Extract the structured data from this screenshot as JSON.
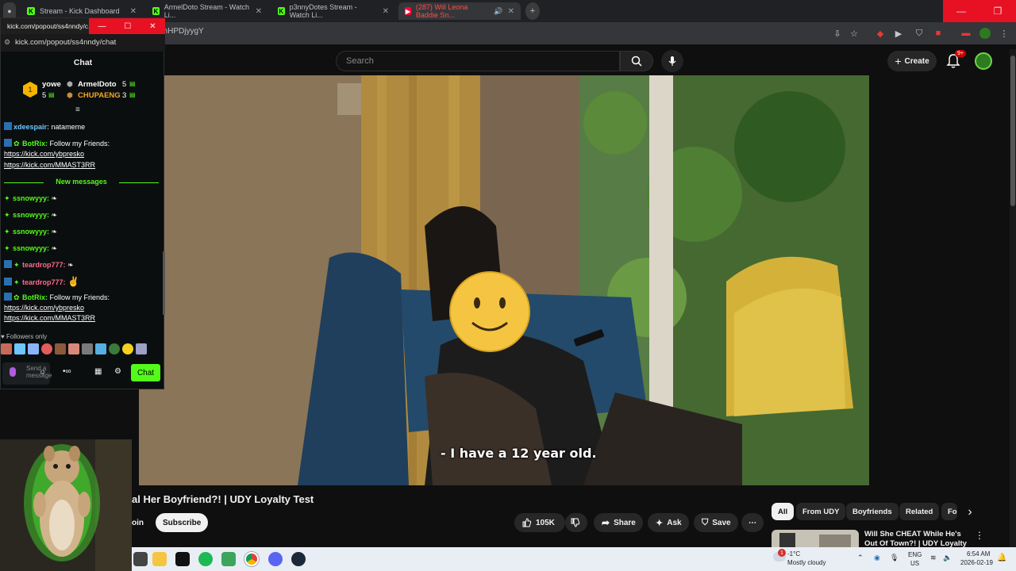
{
  "browser": {
    "tabs": [
      {
        "title": "Stream - Kick Dashboard"
      },
      {
        "title": "ArmelDoto Stream - Watch Li..."
      },
      {
        "title": "p3nnyDotes Stream - Watch Li..."
      },
      {
        "title": "(287) Will Leona Baddie Sn..."
      }
    ],
    "url_fragment": "enHPDjyygY"
  },
  "kick": {
    "window_title": "kick.com/popout/ss4nndy/c...",
    "url": "kick.com/popout/ss4nndy/chat",
    "header": "Chat",
    "leaderboard": [
      {
        "rank": "1",
        "name": "yowe",
        "count": "5"
      },
      {
        "name": "ArmelDoto",
        "count": "5"
      },
      {
        "name": "CHUPAENG",
        "count": "3"
      }
    ],
    "messages_top": [
      {
        "user": "xdeespair:",
        "text": "natameme"
      },
      {
        "user": "BotRix:",
        "text": "Follow my Friends:",
        "links": [
          "https://kick.com/ybpresko",
          "https://kick.com/MMAST3RR"
        ]
      }
    ],
    "new_messages_label": "New messages",
    "messages_new": [
      {
        "user": "ssnowyyy:"
      },
      {
        "user": "ssnowyyy:"
      },
      {
        "user": "ssnowyyy:"
      },
      {
        "user": "ssnowyyy:"
      },
      {
        "user": "teardrop777:"
      },
      {
        "user": "teardrop777:"
      },
      {
        "user": "BotRix:",
        "text": "Follow my Friends:",
        "links": [
          "https://kick.com/ybpresko",
          "https://kick.com/MMAST3RR"
        ]
      }
    ],
    "followers_only": "Followers only",
    "input_placeholder": "Send a message",
    "chat_button": "Chat"
  },
  "youtube": {
    "search_placeholder": "Search",
    "create_label": "Create",
    "notifications_badge": "9+",
    "caption": "- I have a 12 year old.",
    "video_title": "al Her Boyfriend?! | UDY Loyalty Test",
    "join_label": "oin",
    "subscribe_label": "Subscribe",
    "likes": "105K",
    "share_label": "Share",
    "ask_label": "Ask",
    "save_label": "Save",
    "chips": [
      "All",
      "From UDY",
      "Boyfriends",
      "Related",
      "Fo"
    ],
    "recommended_title": "Will She CHEAT While He's Out Of Town?! | UDY Loyalty Test"
  },
  "taskbar": {
    "weather_temp": "-1°C",
    "weather_desc": "Mostly cloudy",
    "weather_badge": "1",
    "lang": "ENG",
    "region": "US",
    "time": "6:54 AM",
    "date": "2026-02-19"
  },
  "colors": {
    "kick_green": "#53fc18",
    "yt_bg": "#0f0f0f",
    "botrix_blue": "#2a6fb0",
    "teardrop_pink": "#ff6b8a"
  }
}
